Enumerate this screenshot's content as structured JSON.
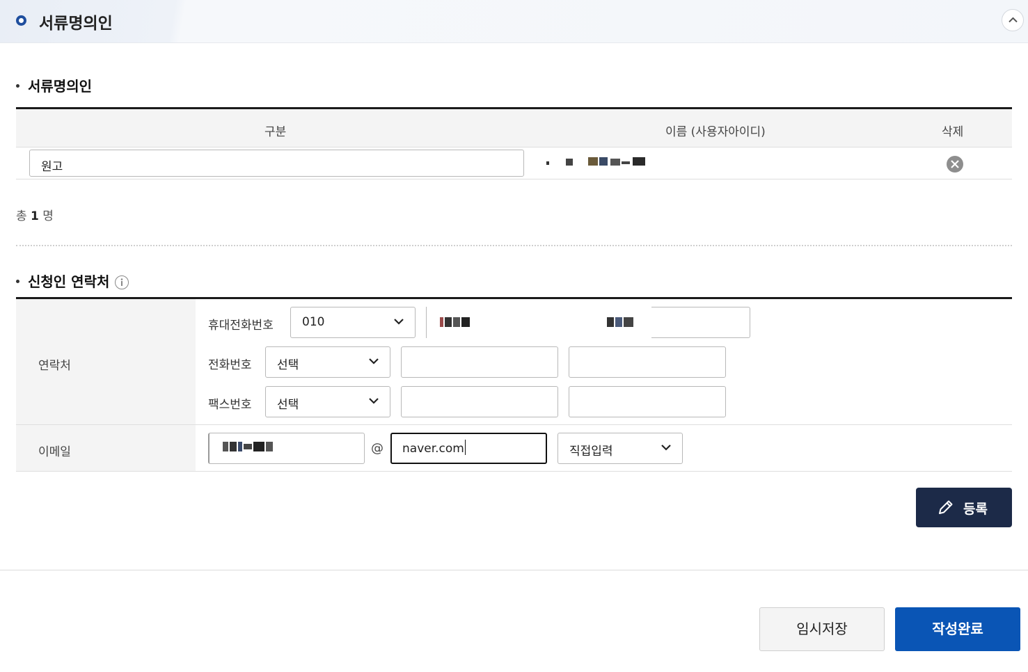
{
  "panel": {
    "title": "서류명의인",
    "collapse_icon": "chevron-up-icon"
  },
  "doc_owner": {
    "section_title": "서류명의인",
    "columns": [
      "구분",
      "이름 (사용자아이디)",
      "삭제"
    ],
    "rows": [
      {
        "category": "원고",
        "name_masked": true,
        "delete_icon": "close-circle-icon"
      }
    ],
    "total_prefix": "총",
    "total_count": "1",
    "total_suffix": "명"
  },
  "contact": {
    "section_title": "신청인 연락처",
    "info_icon": "info-icon",
    "contact_label": "연락처",
    "mobile": {
      "label": "휴대전화번호",
      "prefix": "010"
    },
    "phone": {
      "label": "전화번호",
      "prefix": "선택",
      "mid": "",
      "last": ""
    },
    "fax": {
      "label": "팩스번호",
      "prefix": "선택",
      "mid": "",
      "last": ""
    },
    "email": {
      "label": "이메일",
      "at": "@",
      "domain": "naver.com",
      "domain_select": "직접입력"
    }
  },
  "actions": {
    "register_label": "등록",
    "temp_save_label": "임시저장",
    "complete_label": "작성완료"
  },
  "colors": {
    "primary": "#0a55b5",
    "dark_navy": "#1c2a48",
    "bullet": "#1f4e9e"
  }
}
